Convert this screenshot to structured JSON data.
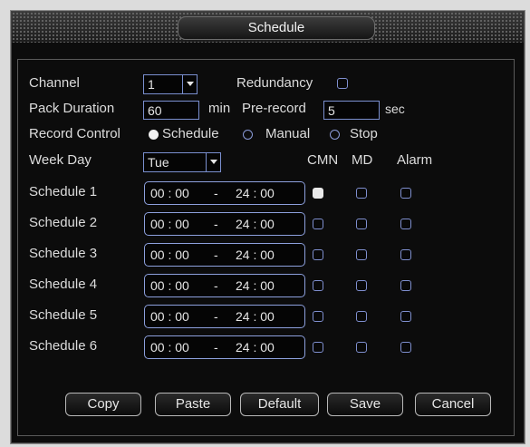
{
  "title": "Schedule",
  "channel": {
    "label": "Channel",
    "value": "1"
  },
  "redundancy": {
    "label": "Redundancy",
    "checked": false
  },
  "pack_duration": {
    "label": "Pack Duration",
    "value": "60",
    "unit": "min"
  },
  "pre_record": {
    "label": "Pre-record",
    "value": "5",
    "unit": "sec"
  },
  "record_control": {
    "label": "Record Control",
    "options": [
      {
        "label": "Schedule",
        "selected": true
      },
      {
        "label": "Manual",
        "selected": false
      },
      {
        "label": "Stop",
        "selected": false
      }
    ]
  },
  "week_day": {
    "label": "Week Day",
    "value": "Tue"
  },
  "columns": {
    "cmn": "CMN",
    "md": "MD",
    "alarm": "Alarm"
  },
  "schedules": [
    {
      "label": "Schedule 1",
      "start": "00 : 00",
      "sep": "-",
      "end": "24 : 00",
      "cmn": true,
      "md": false,
      "alarm": false
    },
    {
      "label": "Schedule 2",
      "start": "00 : 00",
      "sep": "-",
      "end": "24 : 00",
      "cmn": false,
      "md": false,
      "alarm": false
    },
    {
      "label": "Schedule 3",
      "start": "00 : 00",
      "sep": "-",
      "end": "24 : 00",
      "cmn": false,
      "md": false,
      "alarm": false
    },
    {
      "label": "Schedule 4",
      "start": "00 : 00",
      "sep": "-",
      "end": "24 : 00",
      "cmn": false,
      "md": false,
      "alarm": false
    },
    {
      "label": "Schedule 5",
      "start": "00 : 00",
      "sep": "-",
      "end": "24 : 00",
      "cmn": false,
      "md": false,
      "alarm": false
    },
    {
      "label": "Schedule 6",
      "start": "00 : 00",
      "sep": "-",
      "end": "24 : 00",
      "cmn": false,
      "md": false,
      "alarm": false
    }
  ],
  "buttons": {
    "copy": "Copy",
    "paste": "Paste",
    "default": "Default",
    "save": "Save",
    "cancel": "Cancel"
  }
}
